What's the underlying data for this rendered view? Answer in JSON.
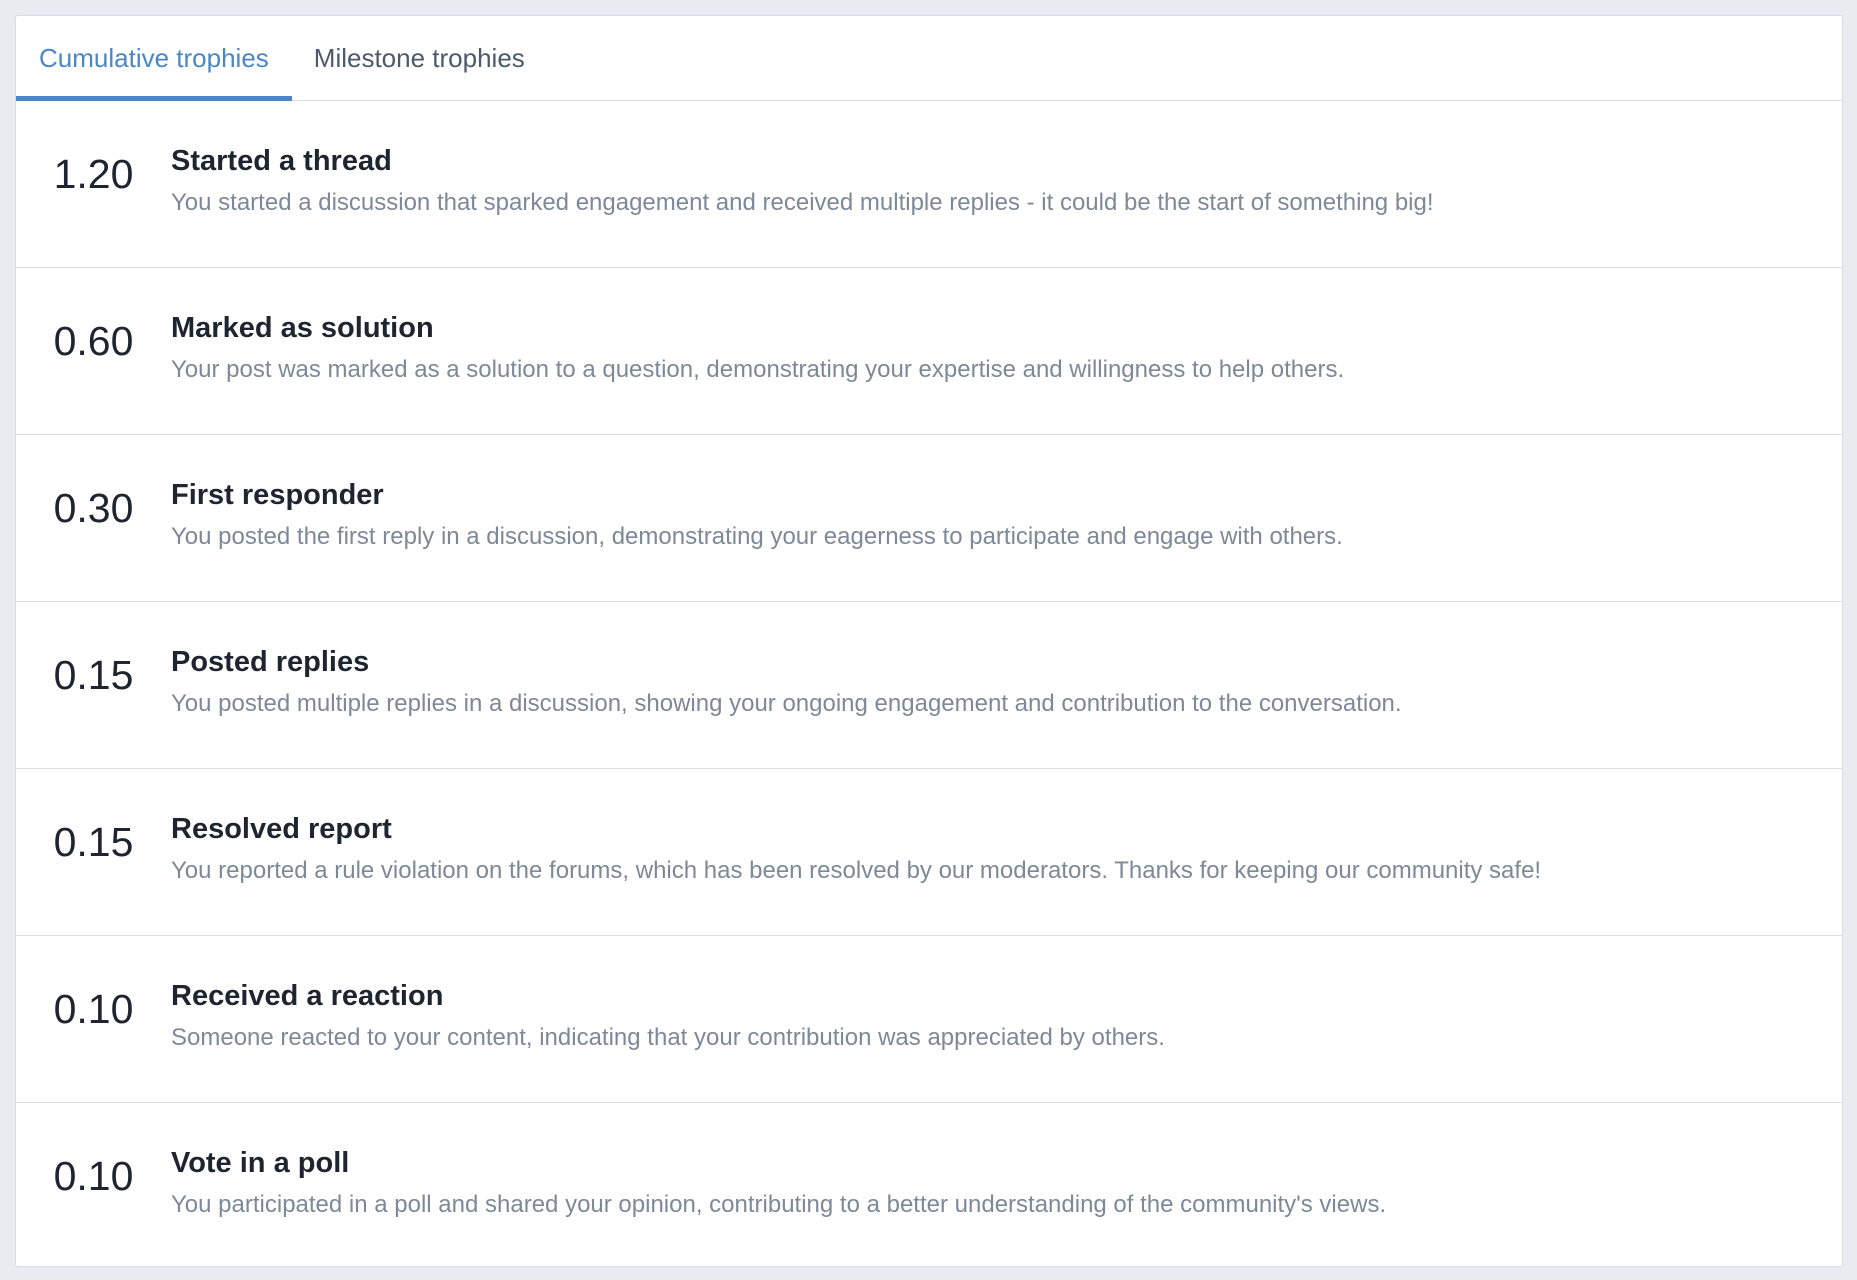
{
  "tabs": [
    {
      "label": "Cumulative trophies",
      "active": true
    },
    {
      "label": "Milestone trophies",
      "active": false
    }
  ],
  "colors": {
    "accent": "#4a86c8",
    "title_text": "#1e2530",
    "description_text": "#7d8998",
    "border": "#d6dde6",
    "page_background": "#e8ecf1"
  },
  "trophies": [
    {
      "points": "1.20",
      "title": "Started a thread",
      "description": "You started a discussion that sparked engagement and received multiple replies - it could be the start of something big!"
    },
    {
      "points": "0.60",
      "title": "Marked as solution",
      "description": "Your post was marked as a solution to a question, demonstrating your expertise and willingness to help others."
    },
    {
      "points": "0.30",
      "title": "First responder",
      "description": "You posted the first reply in a discussion, demonstrating your eagerness to participate and engage with others."
    },
    {
      "points": "0.15",
      "title": "Posted replies",
      "description": "You posted multiple replies in a discussion, showing your ongoing engagement and contribution to the conversation."
    },
    {
      "points": "0.15",
      "title": "Resolved report",
      "description": "You reported a rule violation on the forums, which has been resolved by our moderators. Thanks for keeping our community safe!"
    },
    {
      "points": "0.10",
      "title": "Received a reaction",
      "description": "Someone reacted to your content, indicating that your contribution was appreciated by others."
    },
    {
      "points": "0.10",
      "title": "Vote in a poll",
      "description": "You participated in a poll and shared your opinion, contributing to a better understanding of the community's views."
    }
  ]
}
